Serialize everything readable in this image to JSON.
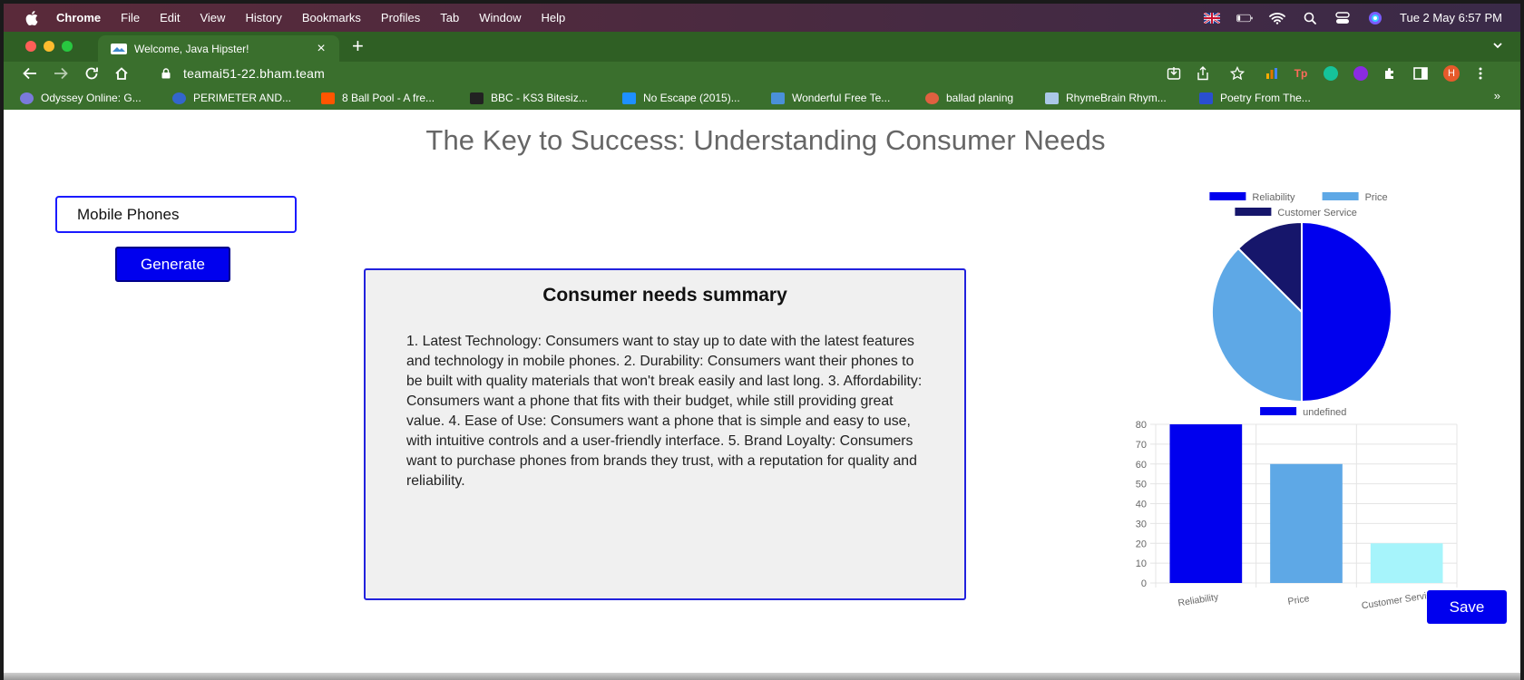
{
  "menubar": {
    "app": "Chrome",
    "items": [
      "File",
      "Edit",
      "View",
      "History",
      "Bookmarks",
      "Profiles",
      "Tab",
      "Window",
      "Help"
    ],
    "clock": "Tue 2 May  6:57 PM"
  },
  "browser": {
    "tab_title": "Welcome, Java Hipster!",
    "url": "teamai51-22.bham.team",
    "bookmarks": [
      {
        "label": "Odyssey Online: G...",
        "color": "#8a8aff"
      },
      {
        "label": "PERIMETER AND...",
        "color": "#3366cc"
      },
      {
        "label": "8 Ball Pool - A fre...",
        "color": "#ff5500"
      },
      {
        "label": "BBC - KS3 Bitesiz...",
        "color": "#222222"
      },
      {
        "label": "No Escape (2015)...",
        "color": "#1e90ff"
      },
      {
        "label": "Wonderful Free Te...",
        "color": "#4a90d9"
      },
      {
        "label": "ballad planing",
        "color": "#e06040"
      },
      {
        "label": "RhymeBrain Rhym...",
        "color": "#aac8e8"
      },
      {
        "label": "Poetry From The...",
        "color": "#2a4fd0"
      }
    ]
  },
  "page": {
    "title": "The Key to Success: Understanding Consumer Needs",
    "input_value": "Mobile Phones",
    "generate_label": "Generate",
    "summary_heading": "Consumer needs summary",
    "summary_text": "1. Latest Technology: Consumers want to stay up to date with the latest features and technology in mobile phones. 2. Durability: Consumers want their phones to be built with quality materials that won't break easily and last long. 3. Affordability: Consumers want a phone that fits with their budget, while still providing great value. 4. Ease of Use: Consumers want a phone that is simple and easy to use, with intuitive controls and a user-friendly interface. 5. Brand Loyalty: Consumers want to purchase phones from brands they trust, with a reputation for quality and reliability.",
    "save_label": "Save"
  },
  "chart_data": [
    {
      "type": "pie",
      "categories": [
        "Reliability",
        "Price",
        "Customer Service"
      ],
      "values": [
        50,
        37.5,
        12.5
      ],
      "colors": [
        "#0000ee",
        "#5ea8e6",
        "#16166b"
      ],
      "legend": "top"
    },
    {
      "type": "bar",
      "categories": [
        "Reliability",
        "Price",
        "Customer Service"
      ],
      "series": [
        {
          "name": "undefined",
          "values": [
            80,
            60,
            20
          ]
        }
      ],
      "colors": [
        "#0000ee",
        "#5ea8e6",
        "#a6f4fb"
      ],
      "ylim": [
        0,
        80
      ],
      "yticks": [
        0,
        10,
        20,
        30,
        40,
        50,
        60,
        70,
        80
      ],
      "grid": true,
      "legend": "top"
    }
  ]
}
